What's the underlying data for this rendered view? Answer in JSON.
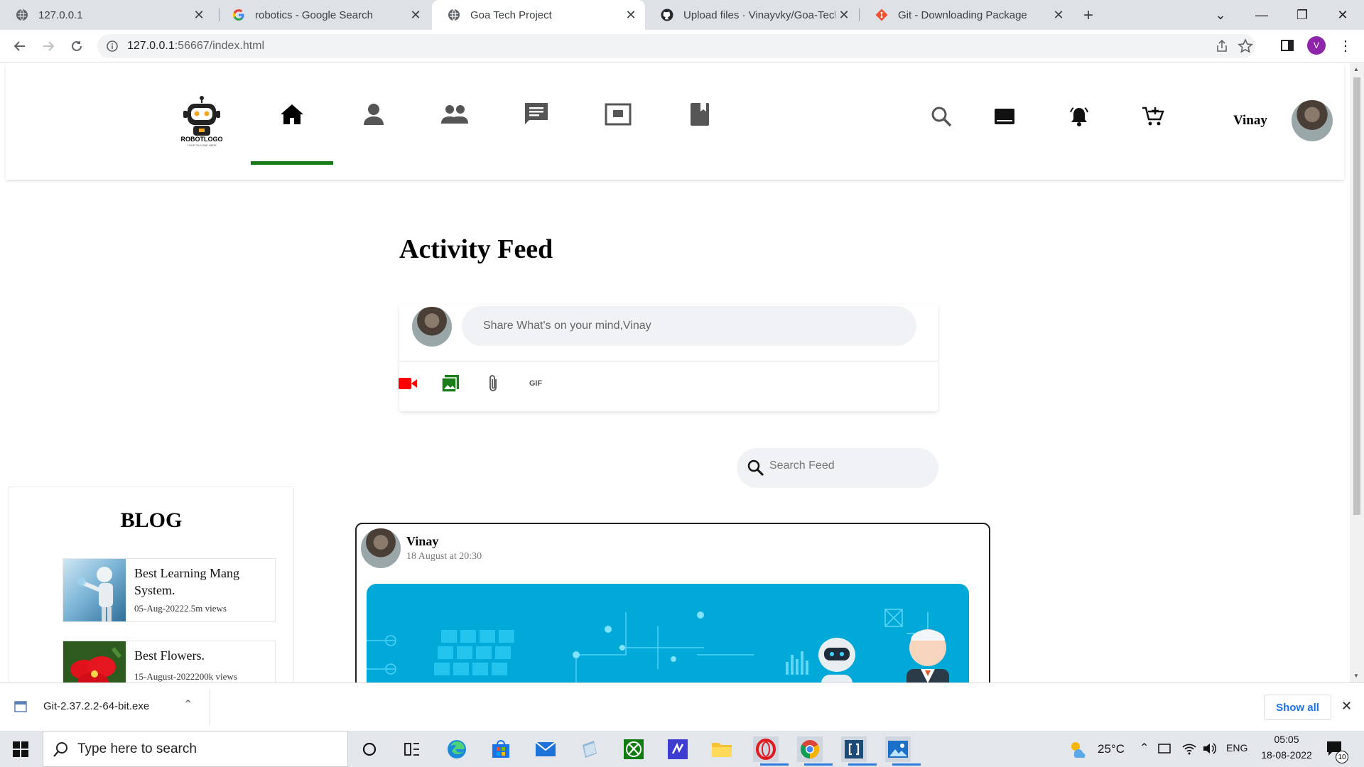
{
  "browser": {
    "tabs": [
      {
        "title": "127.0.0.1",
        "favicon": "globe-icon",
        "active": false
      },
      {
        "title": "robotics - Google Search",
        "favicon": "google-icon",
        "active": false
      },
      {
        "title": "Goa Tech Project",
        "favicon": "globe-icon",
        "active": true
      },
      {
        "title": "Upload files · Vinayvky/Goa-Tech",
        "favicon": "github-icon",
        "active": false
      },
      {
        "title": "Git - Downloading Package",
        "favicon": "git-icon",
        "active": false
      }
    ],
    "url_host": "127.0.0.1",
    "url_rest": ":56667/index.html",
    "profile_initial": "V"
  },
  "header": {
    "logo_text": "ROBOTLOGO",
    "logo_tagline": "YOUR TAGLINE HERE",
    "user_name": "Vinay",
    "accent_color": "#167a16"
  },
  "feed": {
    "title": "Activity Feed",
    "composer_placeholder": "Share What's on your mind,Vinay",
    "gif_label": "GIF",
    "search_placeholder": "Search Feed"
  },
  "blog": {
    "title": "BLOG",
    "items": [
      {
        "name": "Best Learning Mang System.",
        "meta": "05-Aug-20222.5m views"
      },
      {
        "name": "Best Flowers.",
        "meta": "15-August-2022200k views"
      }
    ]
  },
  "post": {
    "author": "Vinay",
    "time": "18 August at 20:30"
  },
  "download": {
    "file": "Git-2.37.2.2-64-bit.exe",
    "show_all": "Show all"
  },
  "taskbar": {
    "search_placeholder": "Type here to search",
    "temperature": "25°C",
    "language": "ENG",
    "time": "05:05",
    "date": "18-08-2022",
    "notifications": "10"
  }
}
